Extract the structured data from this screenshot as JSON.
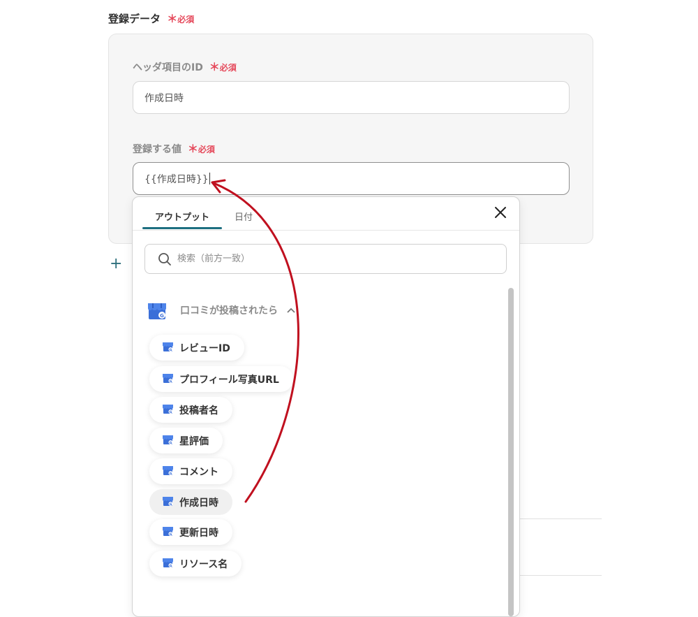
{
  "section": {
    "title": "登録データ",
    "required_mark": "＊",
    "required_label": "必須"
  },
  "header_id": {
    "label": "ヘッダ項目のID",
    "required_mark": "＊",
    "required_label": "必須",
    "value": "作成日時"
  },
  "register_value": {
    "label": "登録する値",
    "required_mark": "＊",
    "required_label": "必須",
    "value": "{{作成日時}}"
  },
  "add_button": {
    "label": "+"
  },
  "dropdown": {
    "tabs": [
      {
        "label": "アウトプット",
        "active": true
      },
      {
        "label": "日付",
        "active": false
      }
    ],
    "close_icon": "close-icon",
    "search": {
      "placeholder": "検索（前方一致）",
      "value": ""
    },
    "group": {
      "title": "口コミが投稿されたら",
      "icon": "google-business-profile-icon",
      "expanded": true
    },
    "items": [
      {
        "label": "レビューID",
        "selected": false
      },
      {
        "label": "プロフィール写真URL",
        "selected": false
      },
      {
        "label": "投稿者名",
        "selected": false
      },
      {
        "label": "星評価",
        "selected": false
      },
      {
        "label": "コメント",
        "selected": false
      },
      {
        "label": "作成日時",
        "selected": true
      },
      {
        "label": "更新日時",
        "selected": false
      },
      {
        "label": "リソース名",
        "selected": false
      }
    ]
  },
  "colors": {
    "required": "#e5485a",
    "accent": "#1d6f80",
    "arrow": "#c0101f",
    "store_icon": "#3b6fd8"
  }
}
